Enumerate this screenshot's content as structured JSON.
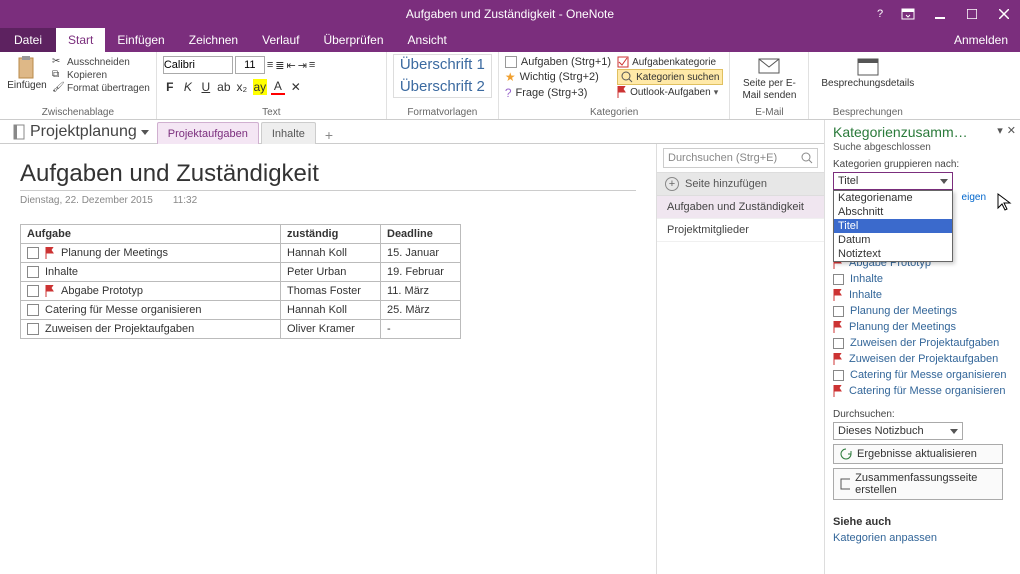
{
  "window": {
    "title": "Aufgaben und Zuständigkeit - OneNote"
  },
  "ribbonTabs": {
    "file": "Datei",
    "items": [
      "Start",
      "Einfügen",
      "Zeichnen",
      "Verlauf",
      "Überprüfen",
      "Ansicht"
    ],
    "signin": "Anmelden"
  },
  "ribbon": {
    "clipboard": {
      "paste": "Einfügen",
      "cut": "Ausschneiden",
      "copy": "Kopieren",
      "formatPainter": "Format übertragen",
      "group": "Zwischenablage"
    },
    "font": {
      "name": "Calibri",
      "size": "11",
      "group": "Text"
    },
    "styles": {
      "h1": "Überschrift 1",
      "h2": "Überschrift 2",
      "group": "Formatvorlagen"
    },
    "tags": {
      "task": "Aufgaben (Strg+1)",
      "important": "Wichtig (Strg+2)",
      "question": "Frage (Strg+3)",
      "taskCat": "Aufgabenkategorie",
      "findCat": "Kategorien suchen",
      "outlook": "Outlook-Aufgaben",
      "group": "Kategorien"
    },
    "email": {
      "line1": "Seite per E-",
      "line2": "Mail senden",
      "group": "E-Mail"
    },
    "meeting": {
      "label": "Besprechungsdetails",
      "group": "Besprechungen"
    }
  },
  "notebook": {
    "name": "Projektplanung"
  },
  "sections": {
    "active": "Projektaufgaben",
    "other": "Inhalte"
  },
  "page": {
    "title": "Aufgaben und Zuständigkeit",
    "date": "Dienstag, 22. Dezember 2015",
    "time": "11:32"
  },
  "table": {
    "headers": [
      "Aufgabe",
      "zuständig",
      "Deadline"
    ],
    "rows": [
      {
        "task": "Planung der Meetings",
        "flag": true,
        "who": "Hannah Koll",
        "due": "15. Januar"
      },
      {
        "task": "Inhalte",
        "flag": false,
        "who": "Peter Urban",
        "due": "19. Februar"
      },
      {
        "task": "Abgabe Prototyp",
        "flag": true,
        "who": "Thomas Foster",
        "due": "11. März"
      },
      {
        "task": "Catering für Messe organisieren",
        "flag": false,
        "who": "Hannah Koll",
        "due": "25. März"
      },
      {
        "task": "Zuweisen der Projektaufgaben",
        "flag": false,
        "who": "Oliver Kramer",
        "due": "-"
      }
    ]
  },
  "search": {
    "placeholder": "Durchsuchen (Strg+E)"
  },
  "pageList": {
    "addPage": "Seite hinzufügen",
    "items": [
      "Aufgaben und Zuständigkeit",
      "Projektmitglieder"
    ]
  },
  "pane": {
    "title": "Kategorienzusamm…",
    "done": "Suche abgeschlossen",
    "groupBy": "Kategorien gruppieren nach:",
    "selected": "Titel",
    "options": [
      "Kategoriename",
      "Abschnitt",
      "Titel",
      "Datum",
      "Notiztext"
    ],
    "showOnly": "eigen",
    "results": [
      {
        "type": "flag",
        "text": "Abgabe Prototyp"
      },
      {
        "type": "check",
        "text": "Inhalte"
      },
      {
        "type": "flag",
        "text": "Inhalte"
      },
      {
        "type": "check",
        "text": "Planung der Meetings"
      },
      {
        "type": "flag",
        "text": "Planung der Meetings"
      },
      {
        "type": "check",
        "text": "Zuweisen der Projektaufgaben"
      },
      {
        "type": "flag",
        "text": "Zuweisen der Projektaufgaben"
      },
      {
        "type": "check",
        "text": "Catering für Messe organisieren"
      },
      {
        "type": "flag",
        "text": "Catering für Messe organisieren"
      }
    ],
    "searchSection": "Durchsuchen:",
    "scope": "Dieses Notizbuch",
    "refresh": "Ergebnisse aktualisieren",
    "summary": "Zusammenfassungsseite erstellen",
    "seeAlso": "Siehe auch",
    "customize": "Kategorien anpassen"
  }
}
